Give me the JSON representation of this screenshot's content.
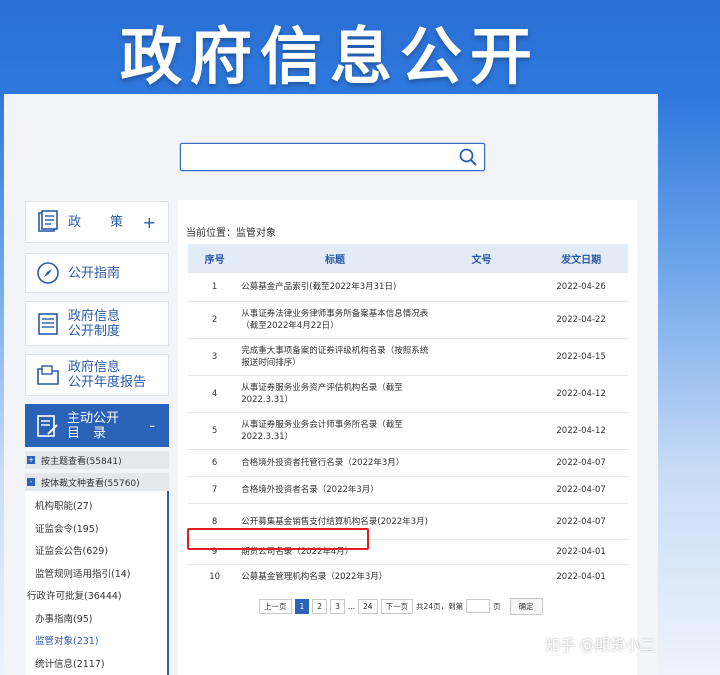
{
  "banner": {
    "title": "政府信息公开"
  },
  "search": {
    "placeholder": ""
  },
  "sidebar": {
    "policy_label": "政　策",
    "policy_toggle": "+",
    "guide_label": "公开指南",
    "system_label_1": "政府信息",
    "system_label_2": "公开制度",
    "report_label_1": "政府信息",
    "report_label_2": "公开年度报告",
    "active_label_1": "主动公开",
    "active_label_2": "目　录",
    "active_toggle": "-",
    "by_topic": "按主题查看(55841)",
    "by_type": "按体裁文种查看(55760)",
    "sub_items": [
      "机构职能(27)",
      "证监会令(195)",
      "证监会公告(629)",
      "监管规则适用指引(14)",
      "行政许可批复(36444)",
      "办事指南(95)",
      "监管对象(231)",
      "统计信息(2117)"
    ]
  },
  "content": {
    "breadcrumb": "当前位置：监管对象",
    "columns": {
      "no": "序号",
      "title": "标题",
      "doc": "文号",
      "date": "发文日期"
    },
    "rows": [
      {
        "no": "1",
        "title": "公募基金产品索引(截至2022年3月31日)",
        "doc": "",
        "date": "2022-04-26"
      },
      {
        "no": "2",
        "title": "从事证券法律业务律师事务所备案基本信息情况表（截至2022年4月22日）",
        "doc": "",
        "date": "2022-04-22"
      },
      {
        "no": "3",
        "title": "完成重大事项备案的证券评级机构名录（按照系统报送时间排序）",
        "doc": "",
        "date": "2022-04-15"
      },
      {
        "no": "4",
        "title": "从事证券服务业务资产评估机构名录（截至2022.3.31）",
        "doc": "",
        "date": "2022-04-12"
      },
      {
        "no": "5",
        "title": "从事证券服务业务会计师事务所名录（截至2022.3.31）",
        "doc": "",
        "date": "2022-04-12"
      },
      {
        "no": "6",
        "title": "合格境外投资者托管行名录（2022年3月）",
        "doc": "",
        "date": "2022-04-07"
      },
      {
        "no": "7",
        "title": "合格境外投资者名录（2022年3月）",
        "doc": "",
        "date": "2022-04-07"
      },
      {
        "no": "8",
        "title": "公开募集基金销售支付结算机构名录(2022年3月)",
        "doc": "",
        "date": "2022-04-07"
      },
      {
        "no": "9",
        "title": "期货公司名录（2022年4月）",
        "doc": "",
        "date": "2022-04-01"
      },
      {
        "no": "10",
        "title": "公募基金管理机构名录（2022年3月）",
        "doc": "",
        "date": "2022-04-01"
      }
    ]
  },
  "pagination": {
    "prev": "上一页",
    "pages": [
      "1",
      "2",
      "3",
      "...",
      "24"
    ],
    "next": "下一页",
    "total": "共24页，到第",
    "page_unit": "页",
    "go": "确定"
  },
  "watermark": "知乎 @期货小二",
  "colors": {
    "accent": "#2a62b8",
    "highlight": "#e02020"
  }
}
